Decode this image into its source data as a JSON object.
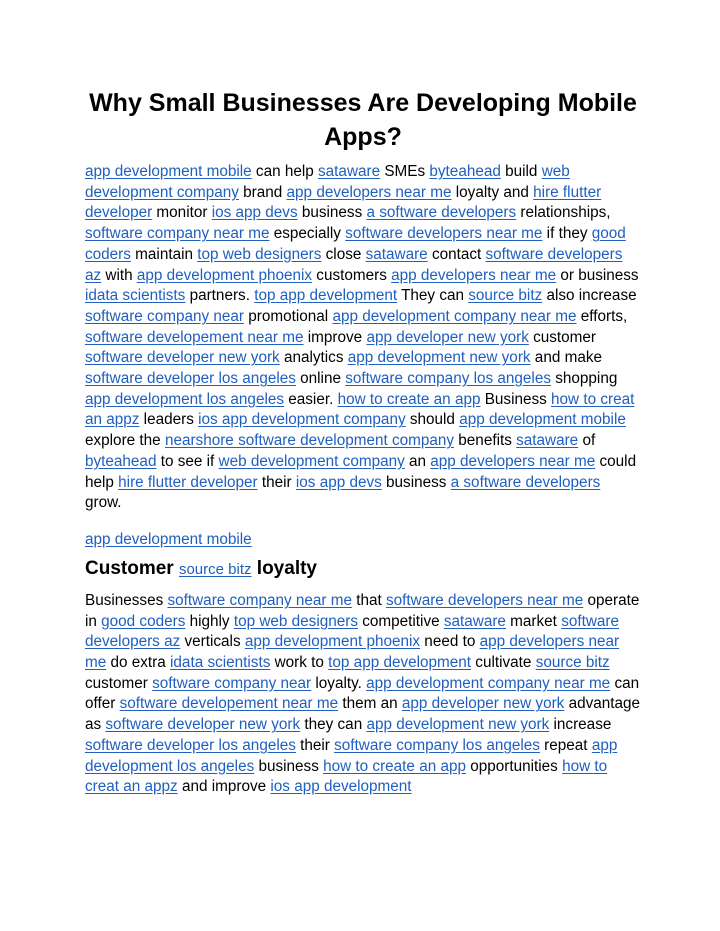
{
  "title": "Why Small Businesses Are Developing Mobile Apps?",
  "link_color": "#1f5fbf",
  "paragraph1": [
    {
      "t": "link",
      "v": "app development mobile"
    },
    {
      "t": "text",
      "v": " can help "
    },
    {
      "t": "link",
      "v": "sataware"
    },
    {
      "t": "text",
      "v": " SMEs "
    },
    {
      "t": "link",
      "v": "byteahead"
    },
    {
      "t": "text",
      "v": " build "
    },
    {
      "t": "link",
      "v": "web development company"
    },
    {
      "t": "text",
      "v": " brand "
    },
    {
      "t": "link",
      "v": "app developers near me"
    },
    {
      "t": "text",
      "v": " loyalty and "
    },
    {
      "t": "link",
      "v": "hire flutter developer"
    },
    {
      "t": "text",
      "v": " monitor "
    },
    {
      "t": "link",
      "v": "ios app devs"
    },
    {
      "t": "text",
      "v": " business "
    },
    {
      "t": "link",
      "v": "a software developers"
    },
    {
      "t": "text",
      "v": " relationships, "
    },
    {
      "t": "link",
      "v": "software company near me"
    },
    {
      "t": "text",
      "v": " especially "
    },
    {
      "t": "link",
      "v": "software developers near me"
    },
    {
      "t": "text",
      "v": " if they "
    },
    {
      "t": "link",
      "v": "good coders"
    },
    {
      "t": "text",
      "v": " maintain "
    },
    {
      "t": "link",
      "v": "top web designers"
    },
    {
      "t": "text",
      "v": " close "
    },
    {
      "t": "link",
      "v": "sataware"
    },
    {
      "t": "text",
      "v": " contact "
    },
    {
      "t": "link",
      "v": "software developers az"
    },
    {
      "t": "text",
      "v": " with "
    },
    {
      "t": "link",
      "v": "app development phoenix"
    },
    {
      "t": "text",
      "v": " customers "
    },
    {
      "t": "link",
      "v": "app developers near me"
    },
    {
      "t": "text",
      "v": " or business "
    },
    {
      "t": "link",
      "v": "idata scientists"
    },
    {
      "t": "text",
      "v": " partners. "
    },
    {
      "t": "link",
      "v": "top app development"
    },
    {
      "t": "text",
      "v": " They can "
    },
    {
      "t": "link",
      "v": "source bitz"
    },
    {
      "t": "text",
      "v": " also increase "
    },
    {
      "t": "link",
      "v": "software company near"
    },
    {
      "t": "text",
      "v": " promotional "
    },
    {
      "t": "link",
      "v": "app development company near me"
    },
    {
      "t": "text",
      "v": " efforts, "
    },
    {
      "t": "link",
      "v": "software developement near me"
    },
    {
      "t": "text",
      "v": " improve "
    },
    {
      "t": "link",
      "v": "app developer new york"
    },
    {
      "t": "text",
      "v": " customer "
    },
    {
      "t": "link",
      "v": "software developer new york"
    },
    {
      "t": "text",
      "v": " analytics "
    },
    {
      "t": "link",
      "v": "app development new york"
    },
    {
      "t": "text",
      "v": " and make "
    },
    {
      "t": "link",
      "v": "software developer los angeles"
    },
    {
      "t": "text",
      "v": " online "
    },
    {
      "t": "link",
      "v": "software company los angeles"
    },
    {
      "t": "text",
      "v": " shopping "
    },
    {
      "t": "link",
      "v": "app development los angeles"
    },
    {
      "t": "text",
      "v": " easier. "
    },
    {
      "t": "link",
      "v": "how to create an app"
    },
    {
      "t": "text",
      "v": " Business "
    },
    {
      "t": "link",
      "v": "how to creat an appz"
    },
    {
      "t": "text",
      "v": " leaders "
    },
    {
      "t": "link",
      "v": "ios app development company"
    },
    {
      "t": "text",
      "v": " should "
    },
    {
      "t": "link",
      "v": "app development mobile"
    },
    {
      "t": "text",
      "v": " explore the "
    },
    {
      "t": "link",
      "v": "nearshore software development company"
    },
    {
      "t": "text",
      "v": " benefits "
    },
    {
      "t": "link",
      "v": "sataware"
    },
    {
      "t": "text",
      "v": " of "
    },
    {
      "t": "link",
      "v": "byteahead"
    },
    {
      "t": "text",
      "v": " to see if "
    },
    {
      "t": "link",
      "v": "web development company"
    },
    {
      "t": "text",
      "v": " an "
    },
    {
      "t": "link",
      "v": "app developers near me"
    },
    {
      "t": "text",
      "v": " could help "
    },
    {
      "t": "link",
      "v": "hire flutter developer"
    },
    {
      "t": "text",
      "v": " their "
    },
    {
      "t": "link",
      "v": "ios app devs"
    },
    {
      "t": "text",
      "v": " business "
    },
    {
      "t": "link",
      "v": "a software developers"
    },
    {
      "t": "text",
      "v": " grow."
    }
  ],
  "standalone_link": "app development mobile",
  "heading2": {
    "before": "Customer ",
    "link": "source bitz",
    "after": " loyalty"
  },
  "paragraph2": [
    {
      "t": "text",
      "v": "Businesses "
    },
    {
      "t": "link",
      "v": "software company near me"
    },
    {
      "t": "text",
      "v": " that "
    },
    {
      "t": "link",
      "v": "software developers near me"
    },
    {
      "t": "text",
      "v": " operate in "
    },
    {
      "t": "link",
      "v": "good coders"
    },
    {
      "t": "text",
      "v": " highly "
    },
    {
      "t": "link",
      "v": "top web designers"
    },
    {
      "t": "text",
      "v": " competitive "
    },
    {
      "t": "link",
      "v": "sataware"
    },
    {
      "t": "text",
      "v": " market "
    },
    {
      "t": "link",
      "v": "software developers az"
    },
    {
      "t": "text",
      "v": " verticals "
    },
    {
      "t": "link",
      "v": "app development phoenix"
    },
    {
      "t": "text",
      "v": " need to "
    },
    {
      "t": "link",
      "v": "app developers near me"
    },
    {
      "t": "text",
      "v": " do extra "
    },
    {
      "t": "link",
      "v": "idata scientists"
    },
    {
      "t": "text",
      "v": " work to "
    },
    {
      "t": "link",
      "v": "top app development"
    },
    {
      "t": "text",
      "v": " cultivate "
    },
    {
      "t": "link",
      "v": "source bitz"
    },
    {
      "t": "text",
      "v": " customer "
    },
    {
      "t": "link",
      "v": "software company near"
    },
    {
      "t": "text",
      "v": " loyalty. "
    },
    {
      "t": "link",
      "v": "app development company near me"
    },
    {
      "t": "text",
      "v": " can offer "
    },
    {
      "t": "link",
      "v": "software developement near me"
    },
    {
      "t": "text",
      "v": " them an "
    },
    {
      "t": "link",
      "v": "app developer new york"
    },
    {
      "t": "text",
      "v": " advantage as "
    },
    {
      "t": "link",
      "v": "software developer new york"
    },
    {
      "t": "text",
      "v": " they can "
    },
    {
      "t": "link",
      "v": "app development new york"
    },
    {
      "t": "text",
      "v": " increase "
    },
    {
      "t": "link",
      "v": "software developer los angeles"
    },
    {
      "t": "text",
      "v": " their "
    },
    {
      "t": "link",
      "v": "software company los angeles"
    },
    {
      "t": "text",
      "v": " repeat "
    },
    {
      "t": "link",
      "v": "app development los angeles"
    },
    {
      "t": "text",
      "v": " business "
    },
    {
      "t": "link",
      "v": "how to create an app"
    },
    {
      "t": "text",
      "v": " opportunities "
    },
    {
      "t": "link",
      "v": "how to creat an appz"
    },
    {
      "t": "text",
      "v": " and improve "
    },
    {
      "t": "link",
      "v": "ios app development"
    }
  ]
}
